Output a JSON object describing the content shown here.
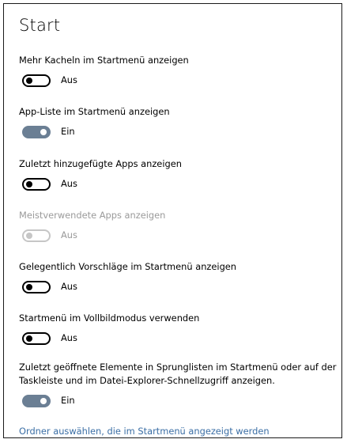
{
  "page": {
    "title": "Start"
  },
  "settings": [
    {
      "label": "Mehr Kacheln im Startmenü anzeigen",
      "state": "Aus",
      "on": false,
      "disabled": false
    },
    {
      "label": "App-Liste im Startmenü anzeigen",
      "state": "Ein",
      "on": true,
      "disabled": false
    },
    {
      "label": "Zuletzt hinzugefügte Apps anzeigen",
      "state": "Aus",
      "on": false,
      "disabled": false
    },
    {
      "label": "Meistverwendete Apps anzeigen",
      "state": "Aus",
      "on": false,
      "disabled": true
    },
    {
      "label": "Gelegentlich Vorschläge im Startmenü anzeigen",
      "state": "Aus",
      "on": false,
      "disabled": false
    },
    {
      "label": "Startmenü im Vollbildmodus verwenden",
      "state": "Aus",
      "on": false,
      "disabled": false
    },
    {
      "label": "Zuletzt geöffnete Elemente in Sprunglisten im Startmenü oder auf der Taskleiste und im Datei-Explorer-Schnellzugriff anzeigen.",
      "state": "Ein",
      "on": true,
      "disabled": false
    }
  ],
  "link": {
    "label": "Ordner auswählen, die im Startmenü angezeigt werden"
  },
  "colors": {
    "toggle_on": "#6b7f94",
    "link": "#3a6ea5",
    "disabled_text": "#9a9a9a"
  }
}
